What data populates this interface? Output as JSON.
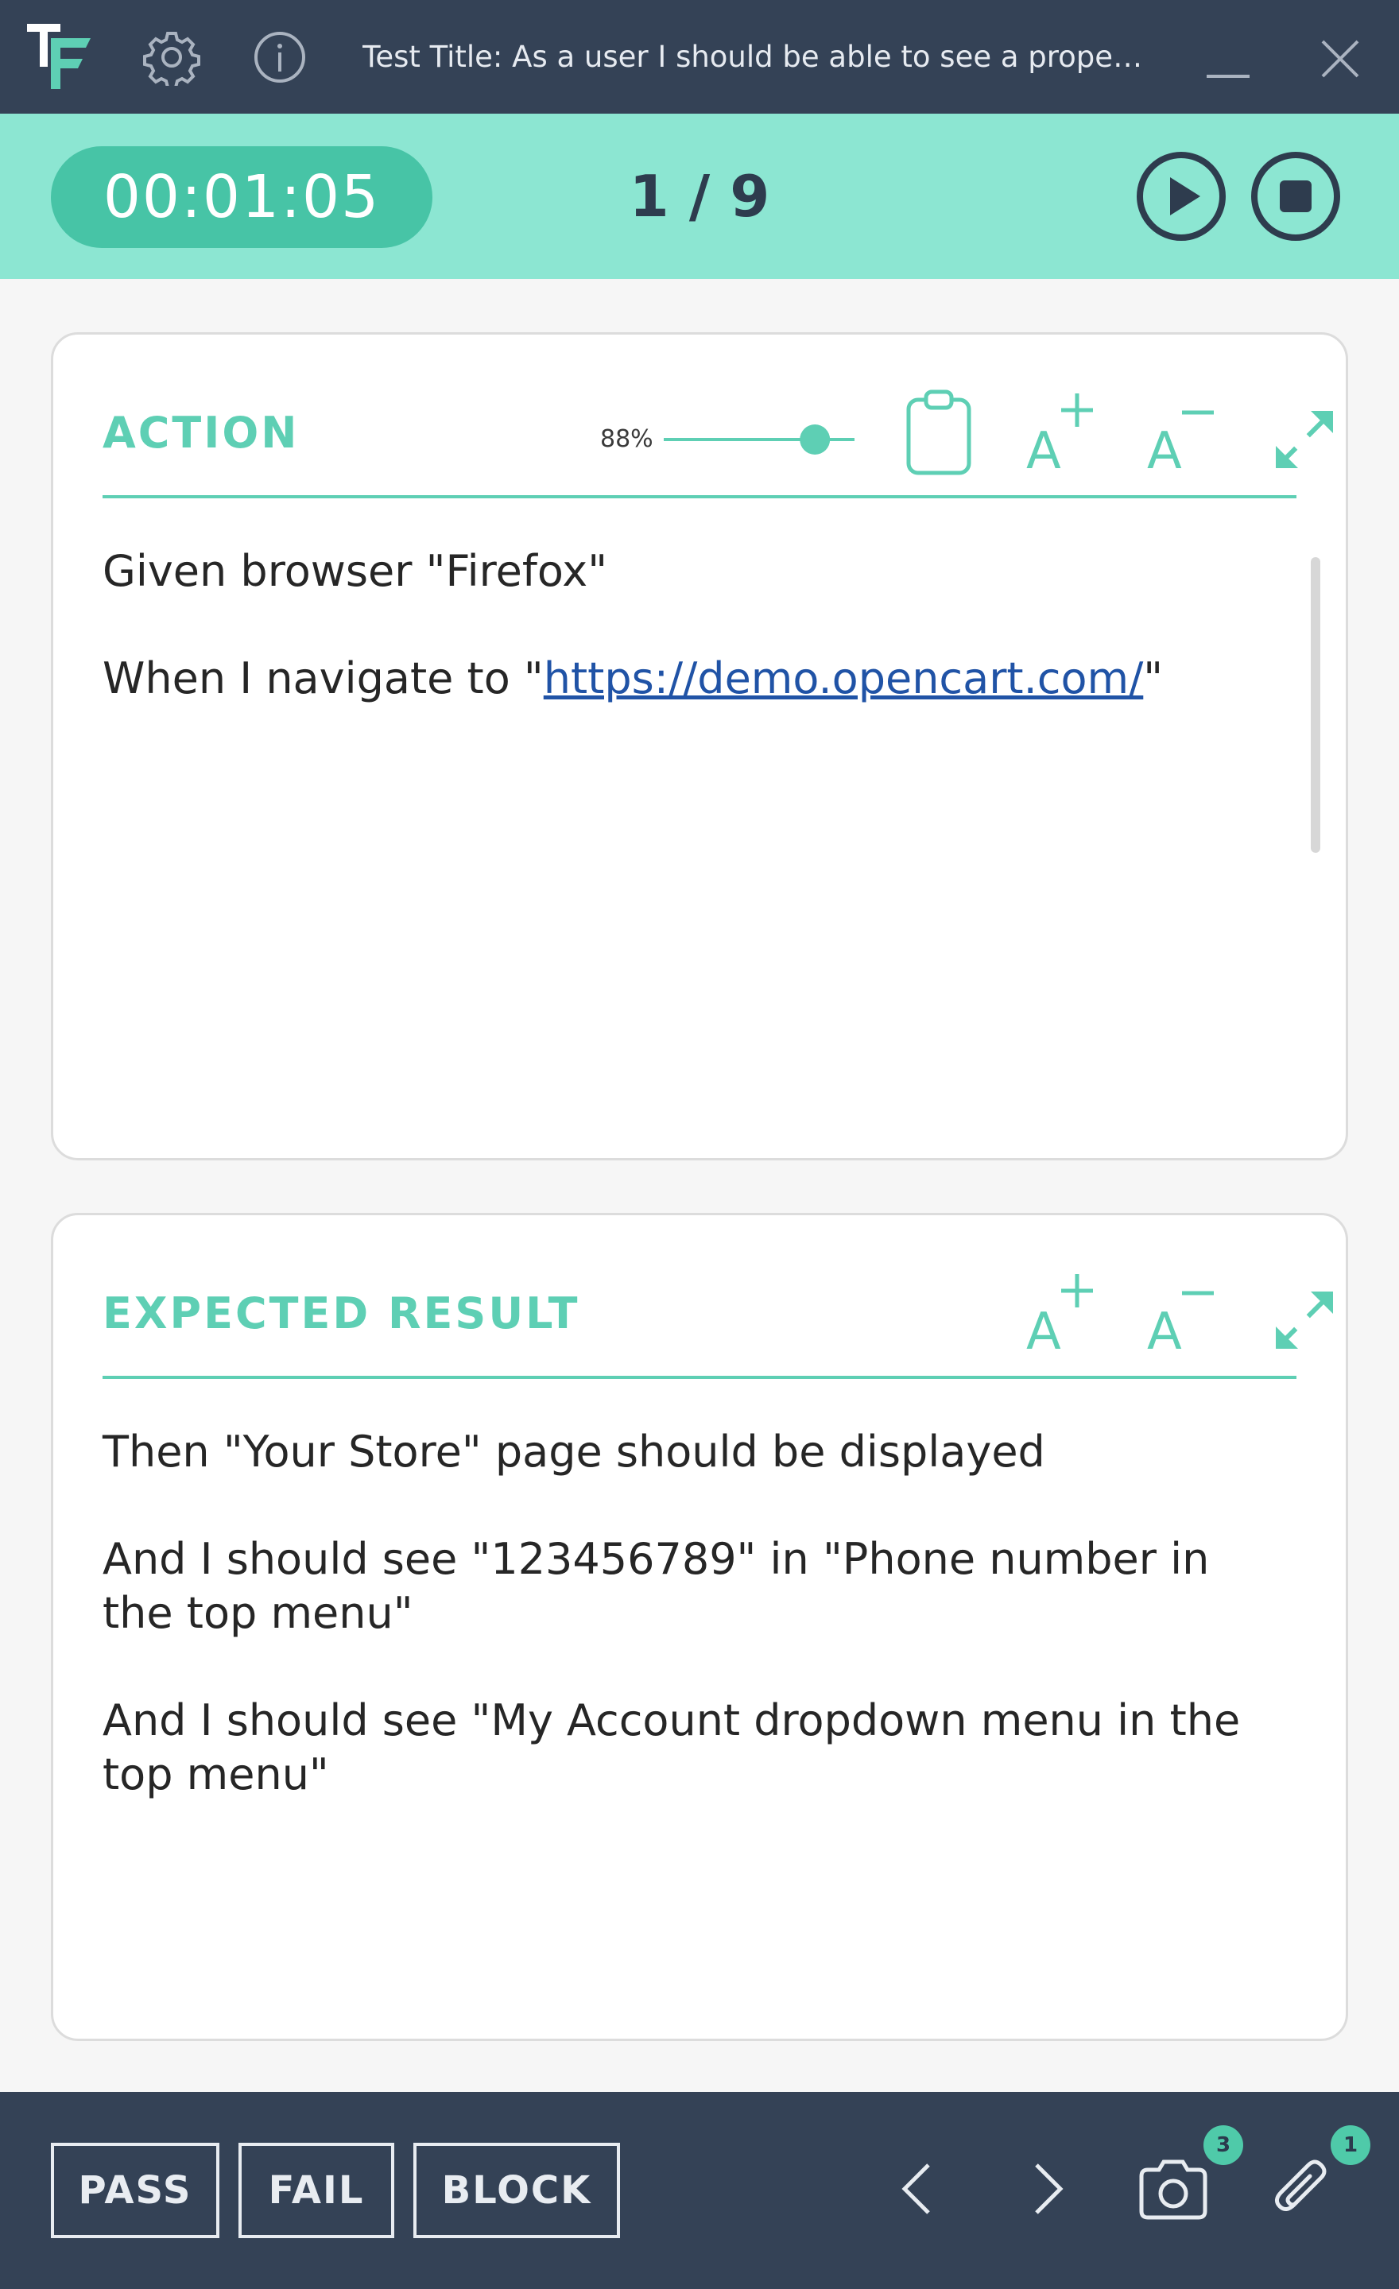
{
  "window": {
    "title": "Test Title: As a user I should be able to see a properly rend..."
  },
  "timer": {
    "elapsed": "00:01:05",
    "step_current": "1",
    "step_separator": " / ",
    "step_total": "9"
  },
  "action_card": {
    "title": "ACTION",
    "zoom": "88%",
    "zoom_fraction": 0.88,
    "lines": [
      {
        "before": "Given browser \"Firefox\""
      },
      {
        "before": "When I navigate to \"",
        "link": "https://demo.opencart.com/",
        "after": "\""
      }
    ]
  },
  "expected_card": {
    "title": "EXPECTED RESULT",
    "lines": [
      "Then \"Your Store\" page should be displayed",
      "And I should see \"123456789\" in \"Phone number in the top menu\"",
      "And I should see \"My Account dropdown menu in the top menu\""
    ]
  },
  "footer": {
    "pass_label": "PASS",
    "fail_label": "FAIL",
    "block_label": "BLOCK",
    "screenshot_count": "3",
    "attachment_count": "1"
  },
  "icons": {
    "logo": "tf-logo",
    "settings": "gear-icon",
    "info": "info-icon",
    "minimize": "minimize-icon",
    "close": "close-icon",
    "play": "play-icon",
    "stop": "stop-icon",
    "clipboard": "clipboard-icon",
    "font_increase": "font-increase-icon",
    "font_decrease": "font-decrease-icon",
    "expand": "expand-icon",
    "prev": "chevron-left-icon",
    "next": "chevron-right-icon",
    "camera": "camera-icon",
    "attachment": "paperclip-icon"
  },
  "colors": {
    "header_bg": "#344256",
    "timer_bar_bg": "#8ce6d2",
    "timer_pill_bg": "#47c4a6",
    "accent": "#5ecfb4",
    "link": "#2053a6"
  }
}
